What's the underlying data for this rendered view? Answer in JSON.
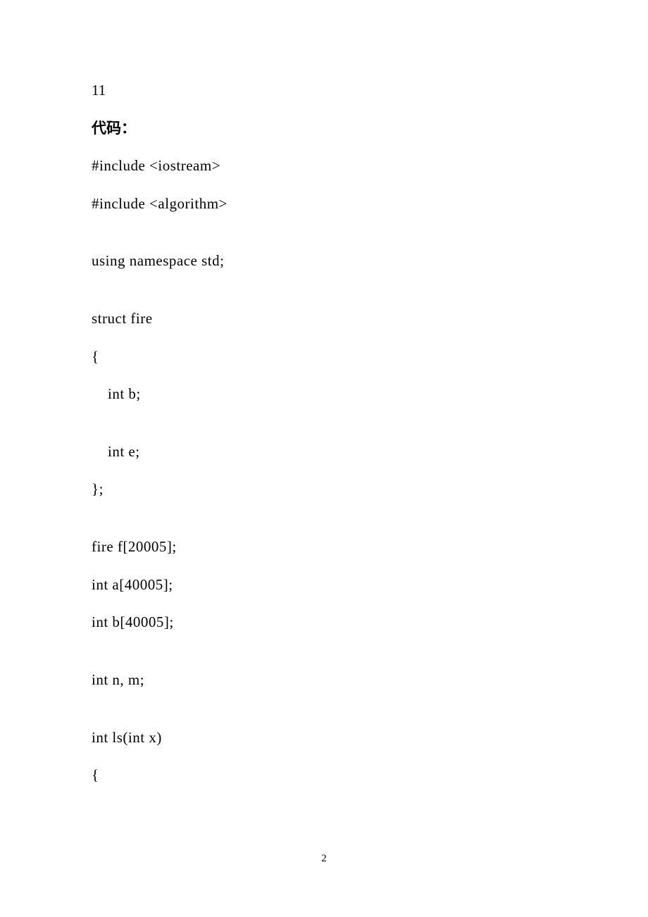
{
  "line_11": "11",
  "heading_code": "代码：",
  "code": {
    "l1": "#include <iostream>",
    "l2": "#include <algorithm>",
    "l3": "using namespace std;",
    "l4": "struct fire",
    "l5": "{",
    "l6": "    int b;",
    "l7": "    int e;",
    "l8": "};",
    "l9": "fire f[20005];",
    "l10": "int a[40005];",
    "l11": "int b[40005];",
    "l12": "int n, m;",
    "l13": "int ls(int x)",
    "l14": "{"
  },
  "page_number": "2"
}
